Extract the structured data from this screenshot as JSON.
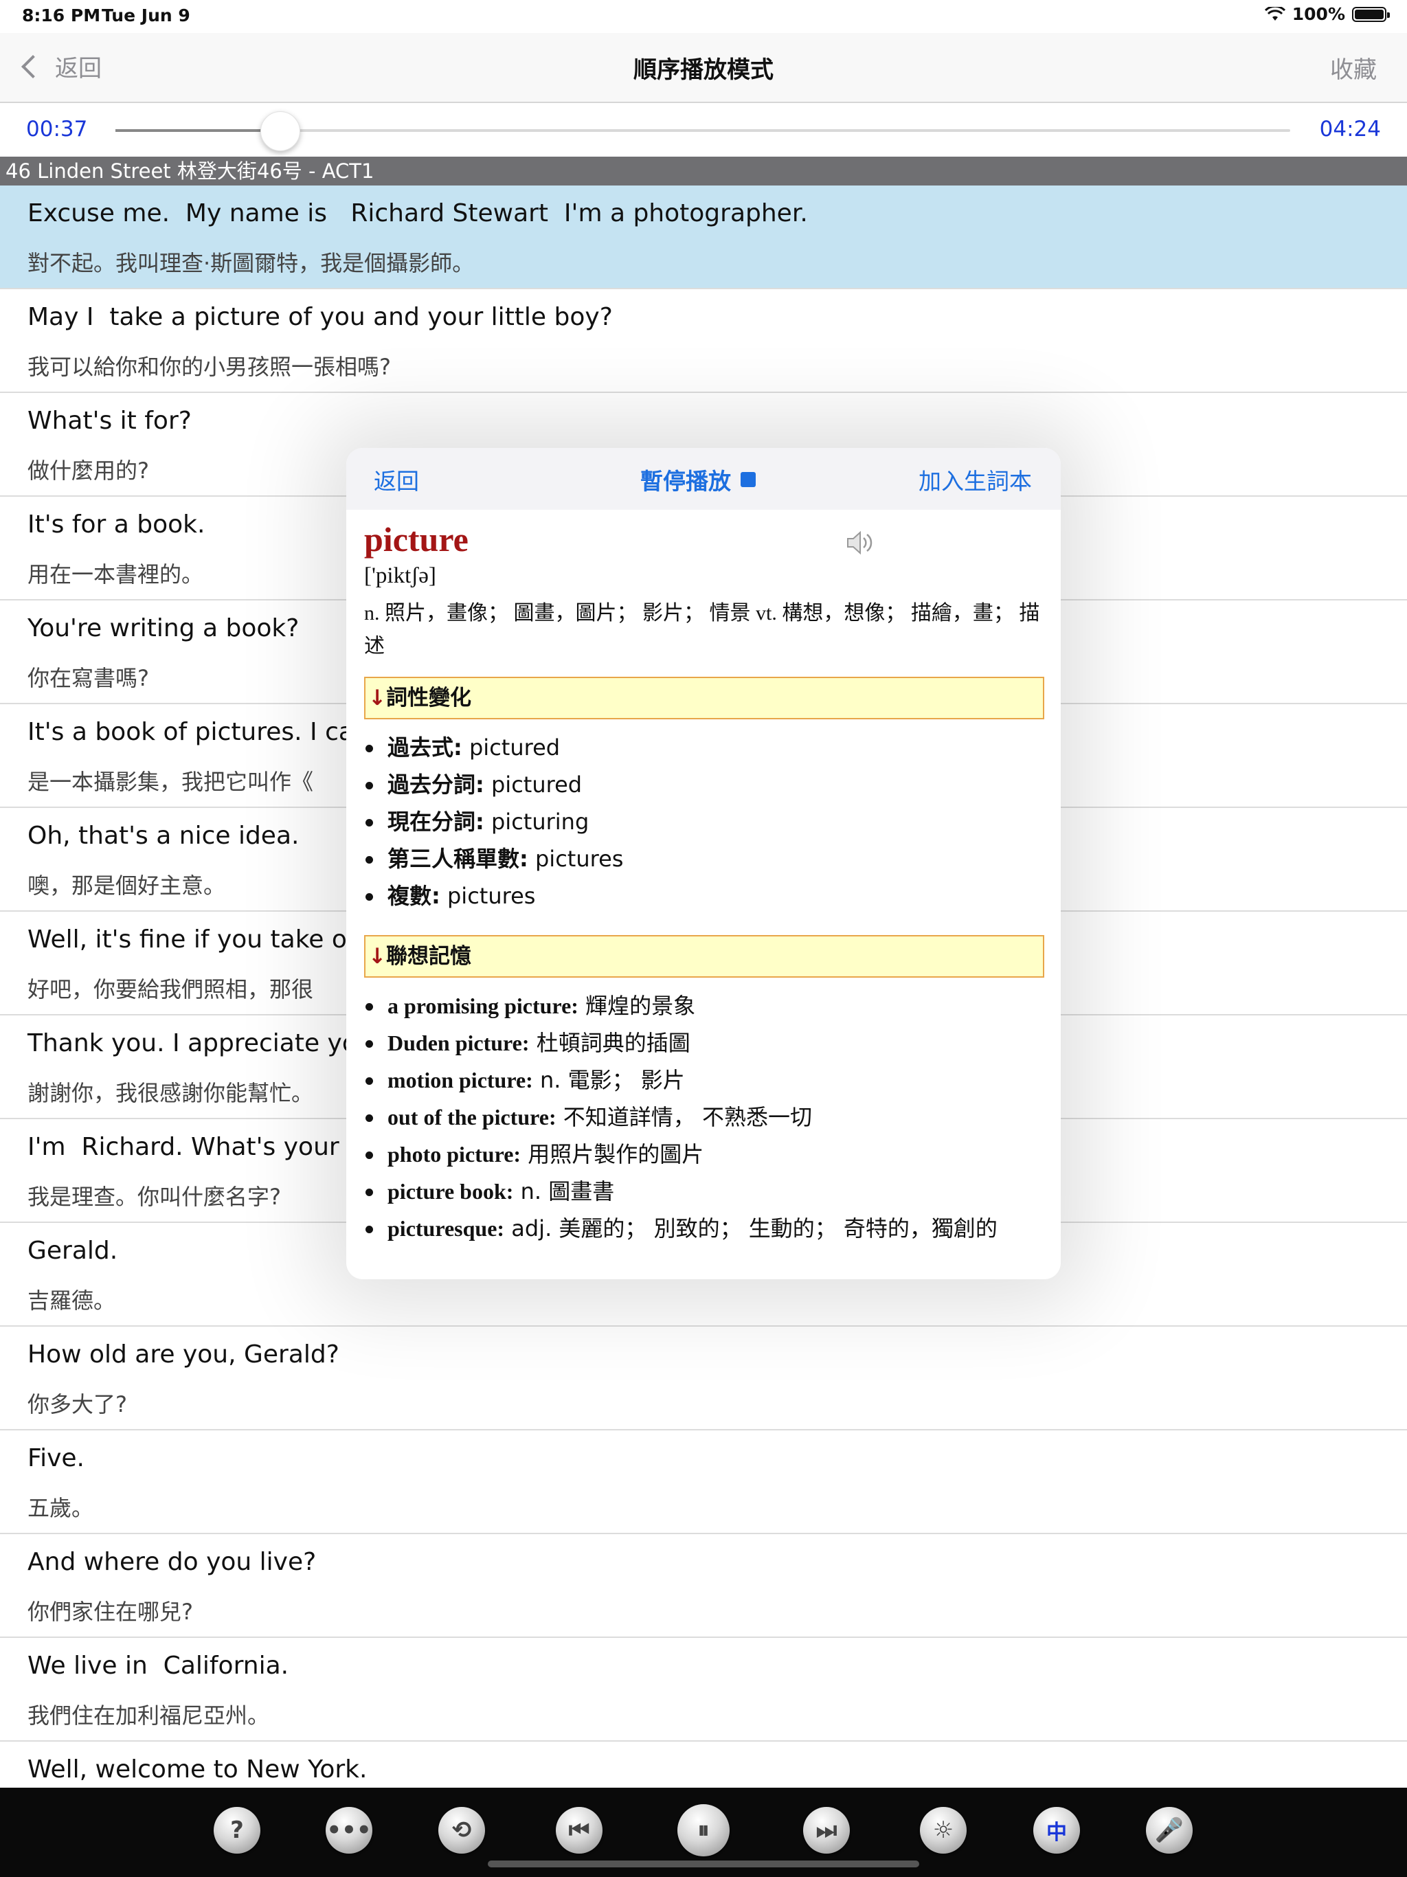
{
  "status": {
    "time": "8:16 PM",
    "date": "Tue Jun 9",
    "battery": "100%"
  },
  "nav": {
    "back": "返回",
    "title": "順序播放模式",
    "favorite": "收藏"
  },
  "player": {
    "current": "00:37",
    "total": "04:24",
    "progress": 0.14
  },
  "section": "46 Linden Street 林登大街46号 - ACT1",
  "rows": [
    {
      "en": "Excuse me.  My name is   Richard Stewart  I'm a photographer.",
      "zh": "對不起。我叫理查·斯圖爾特，我是個攝影師。"
    },
    {
      "en": "May I  take a picture of you and your little boy?",
      "zh": "我可以給你和你的小男孩照一張相嗎?"
    },
    {
      "en": "What's it for?",
      "zh": "做什麼用的?"
    },
    {
      "en": "It's for a book.",
      "zh": "用在一本書裡的。"
    },
    {
      "en": "You're writing a book?",
      "zh": "你在寫書嗎?"
    },
    {
      "en": "It's a book of pictures. I call",
      "zh": "是一本攝影集，我把它叫作《"
    },
    {
      "en": "Oh, that's a nice idea.",
      "zh": "噢，那是個好主意。"
    },
    {
      "en": "Well, it's fine if you take our",
      "zh": "好吧，你要給我們照相，那很"
    },
    {
      "en": "Thank you. I appreciate you",
      "zh": "謝謝你，我很感謝你能幫忙。"
    },
    {
      "en": "I'm  Richard. What's your na",
      "zh": "我是理查。你叫什麼名字?"
    },
    {
      "en": "Gerald.",
      "zh": "吉羅德。"
    },
    {
      "en": "How old are you, Gerald?",
      "zh": "你多大了?"
    },
    {
      "en": "Five.",
      "zh": "五歲。"
    },
    {
      "en": "And where do you live?",
      "zh": "你們家住在哪兒?"
    },
    {
      "en": "We live in  California.",
      "zh": "我們住在加利福尼亞州。"
    },
    {
      "en": "Well, welcome to New York.",
      "zh": ""
    }
  ],
  "popup": {
    "back": "返回",
    "pause": "暫停播放",
    "add": "加入生詞本",
    "word": "picture",
    "phonetic": "['piktʃə]",
    "definition": "n. 照片，畫像； 圖畫，圖片； 影片； 情景 vt. 構想，想像； 描繪，畫； 描述",
    "section1": "詞性變化",
    "forms": [
      {
        "label": "過去式:",
        "value": " pictured"
      },
      {
        "label": "過去分詞:",
        "value": " pictured"
      },
      {
        "label": "現在分詞:",
        "value": " picturing"
      },
      {
        "label": "第三人稱單數:",
        "value": " pictures"
      },
      {
        "label": "複數:",
        "value": " pictures"
      }
    ],
    "section2": "聯想記憶",
    "assoc": [
      {
        "label": "a promising picture:",
        "value": " 輝煌的景象"
      },
      {
        "label": "Duden picture:",
        "value": " 杜頓詞典的插圖"
      },
      {
        "label": "motion picture:",
        "value": " n. 電影； 影片"
      },
      {
        "label": "out of the picture:",
        "value": " 不知道詳情， 不熟悉一切"
      },
      {
        "label": "photo picture:",
        "value": " 用照片製作的圖片"
      },
      {
        "label": "picture book:",
        "value": " n. 圖畫書"
      },
      {
        "label": "picturesque:",
        "value": " adj. 美麗的； 別致的； 生動的； 奇特的，獨創的"
      }
    ]
  },
  "toolbar": {
    "buttons": [
      {
        "name": "help-button",
        "glyph": "?"
      },
      {
        "name": "more-button",
        "glyph": "•••"
      },
      {
        "name": "repeat-button",
        "glyph": "⟲"
      },
      {
        "name": "previous-button",
        "glyph": "⏮"
      },
      {
        "name": "pause-button",
        "glyph": "⏸"
      },
      {
        "name": "next-button",
        "glyph": "⏭"
      },
      {
        "name": "brightness-button",
        "glyph": "☼"
      },
      {
        "name": "chinese-toggle-button",
        "glyph": "中"
      },
      {
        "name": "record-button",
        "glyph": "🎤"
      }
    ]
  }
}
